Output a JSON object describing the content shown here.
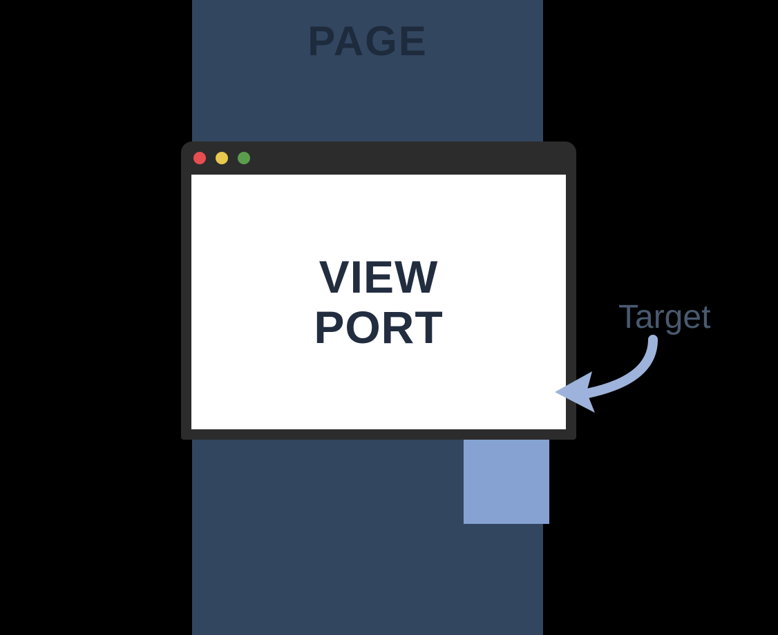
{
  "page": {
    "label": "PAGE"
  },
  "viewport": {
    "line1": "VIEW",
    "line2": "PORT"
  },
  "target": {
    "label": "Target"
  },
  "colors": {
    "page_bg": "#334660",
    "page_label": "#1d2b3d",
    "window_frame": "#2c2c2c",
    "viewport_bg": "#ffffff",
    "viewport_text": "#222d3f",
    "target_visible": "#375c9c",
    "target_hidden": "#85a2d2",
    "target_label": "#485a6f",
    "arrow": "#9eb3db",
    "dot_red": "#e84d52",
    "dot_yellow": "#e8c84d",
    "dot_green": "#5a9e4d"
  }
}
